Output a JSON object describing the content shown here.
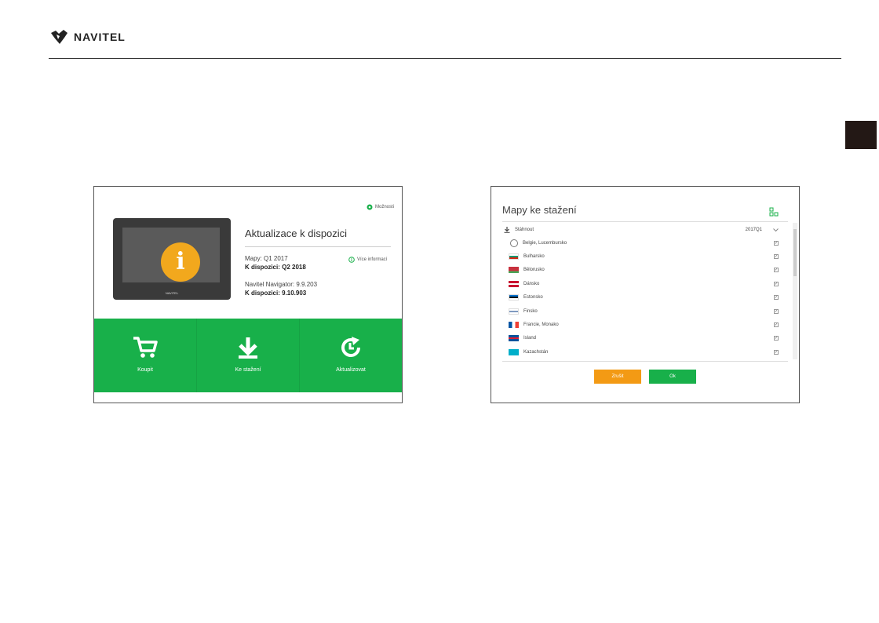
{
  "header": {
    "brand": "NAVITEL"
  },
  "update_screen": {
    "options_label": "Možnosti",
    "device_brand": "NAVITEL",
    "title": "Aktualizace k dispozici",
    "maps_line": "Mapy: Q1 2017",
    "maps_available": "K dispozici: Q2 2018",
    "more_info": "Více informací",
    "navigator_line": "Navitel Navigator: 9.9.203",
    "navigator_available": "K dispozici: 9.10.903",
    "actions": [
      {
        "label": "Koupit",
        "icon": "cart-icon"
      },
      {
        "label": "Ke stažení",
        "icon": "download-icon"
      },
      {
        "label": "Aktualizovat",
        "icon": "refresh-icon"
      }
    ]
  },
  "maps_screen": {
    "title": "Mapy ke stažení",
    "download_label": "Stáhnout",
    "version": "2017Q1",
    "items": [
      {
        "name": "Belgie, Lucembursko",
        "flag": "globe"
      },
      {
        "name": "Bulharsko",
        "flag": "bg"
      },
      {
        "name": "Bělorusko",
        "flag": "by"
      },
      {
        "name": "Dánsko",
        "flag": "dk"
      },
      {
        "name": "Estonsko",
        "flag": "ee"
      },
      {
        "name": "Finsko",
        "flag": "fi"
      },
      {
        "name": "Francie, Monako",
        "flag": "fr"
      },
      {
        "name": "Island",
        "flag": "is"
      },
      {
        "name": "Kazachstán",
        "flag": "kz"
      }
    ],
    "cancel_label": "Zrušit",
    "ok_label": "Ok"
  },
  "colors": {
    "green": "#18b04a",
    "orange": "#f39a14",
    "info_yellow": "#f2a81d",
    "side_tab": "#231815"
  }
}
